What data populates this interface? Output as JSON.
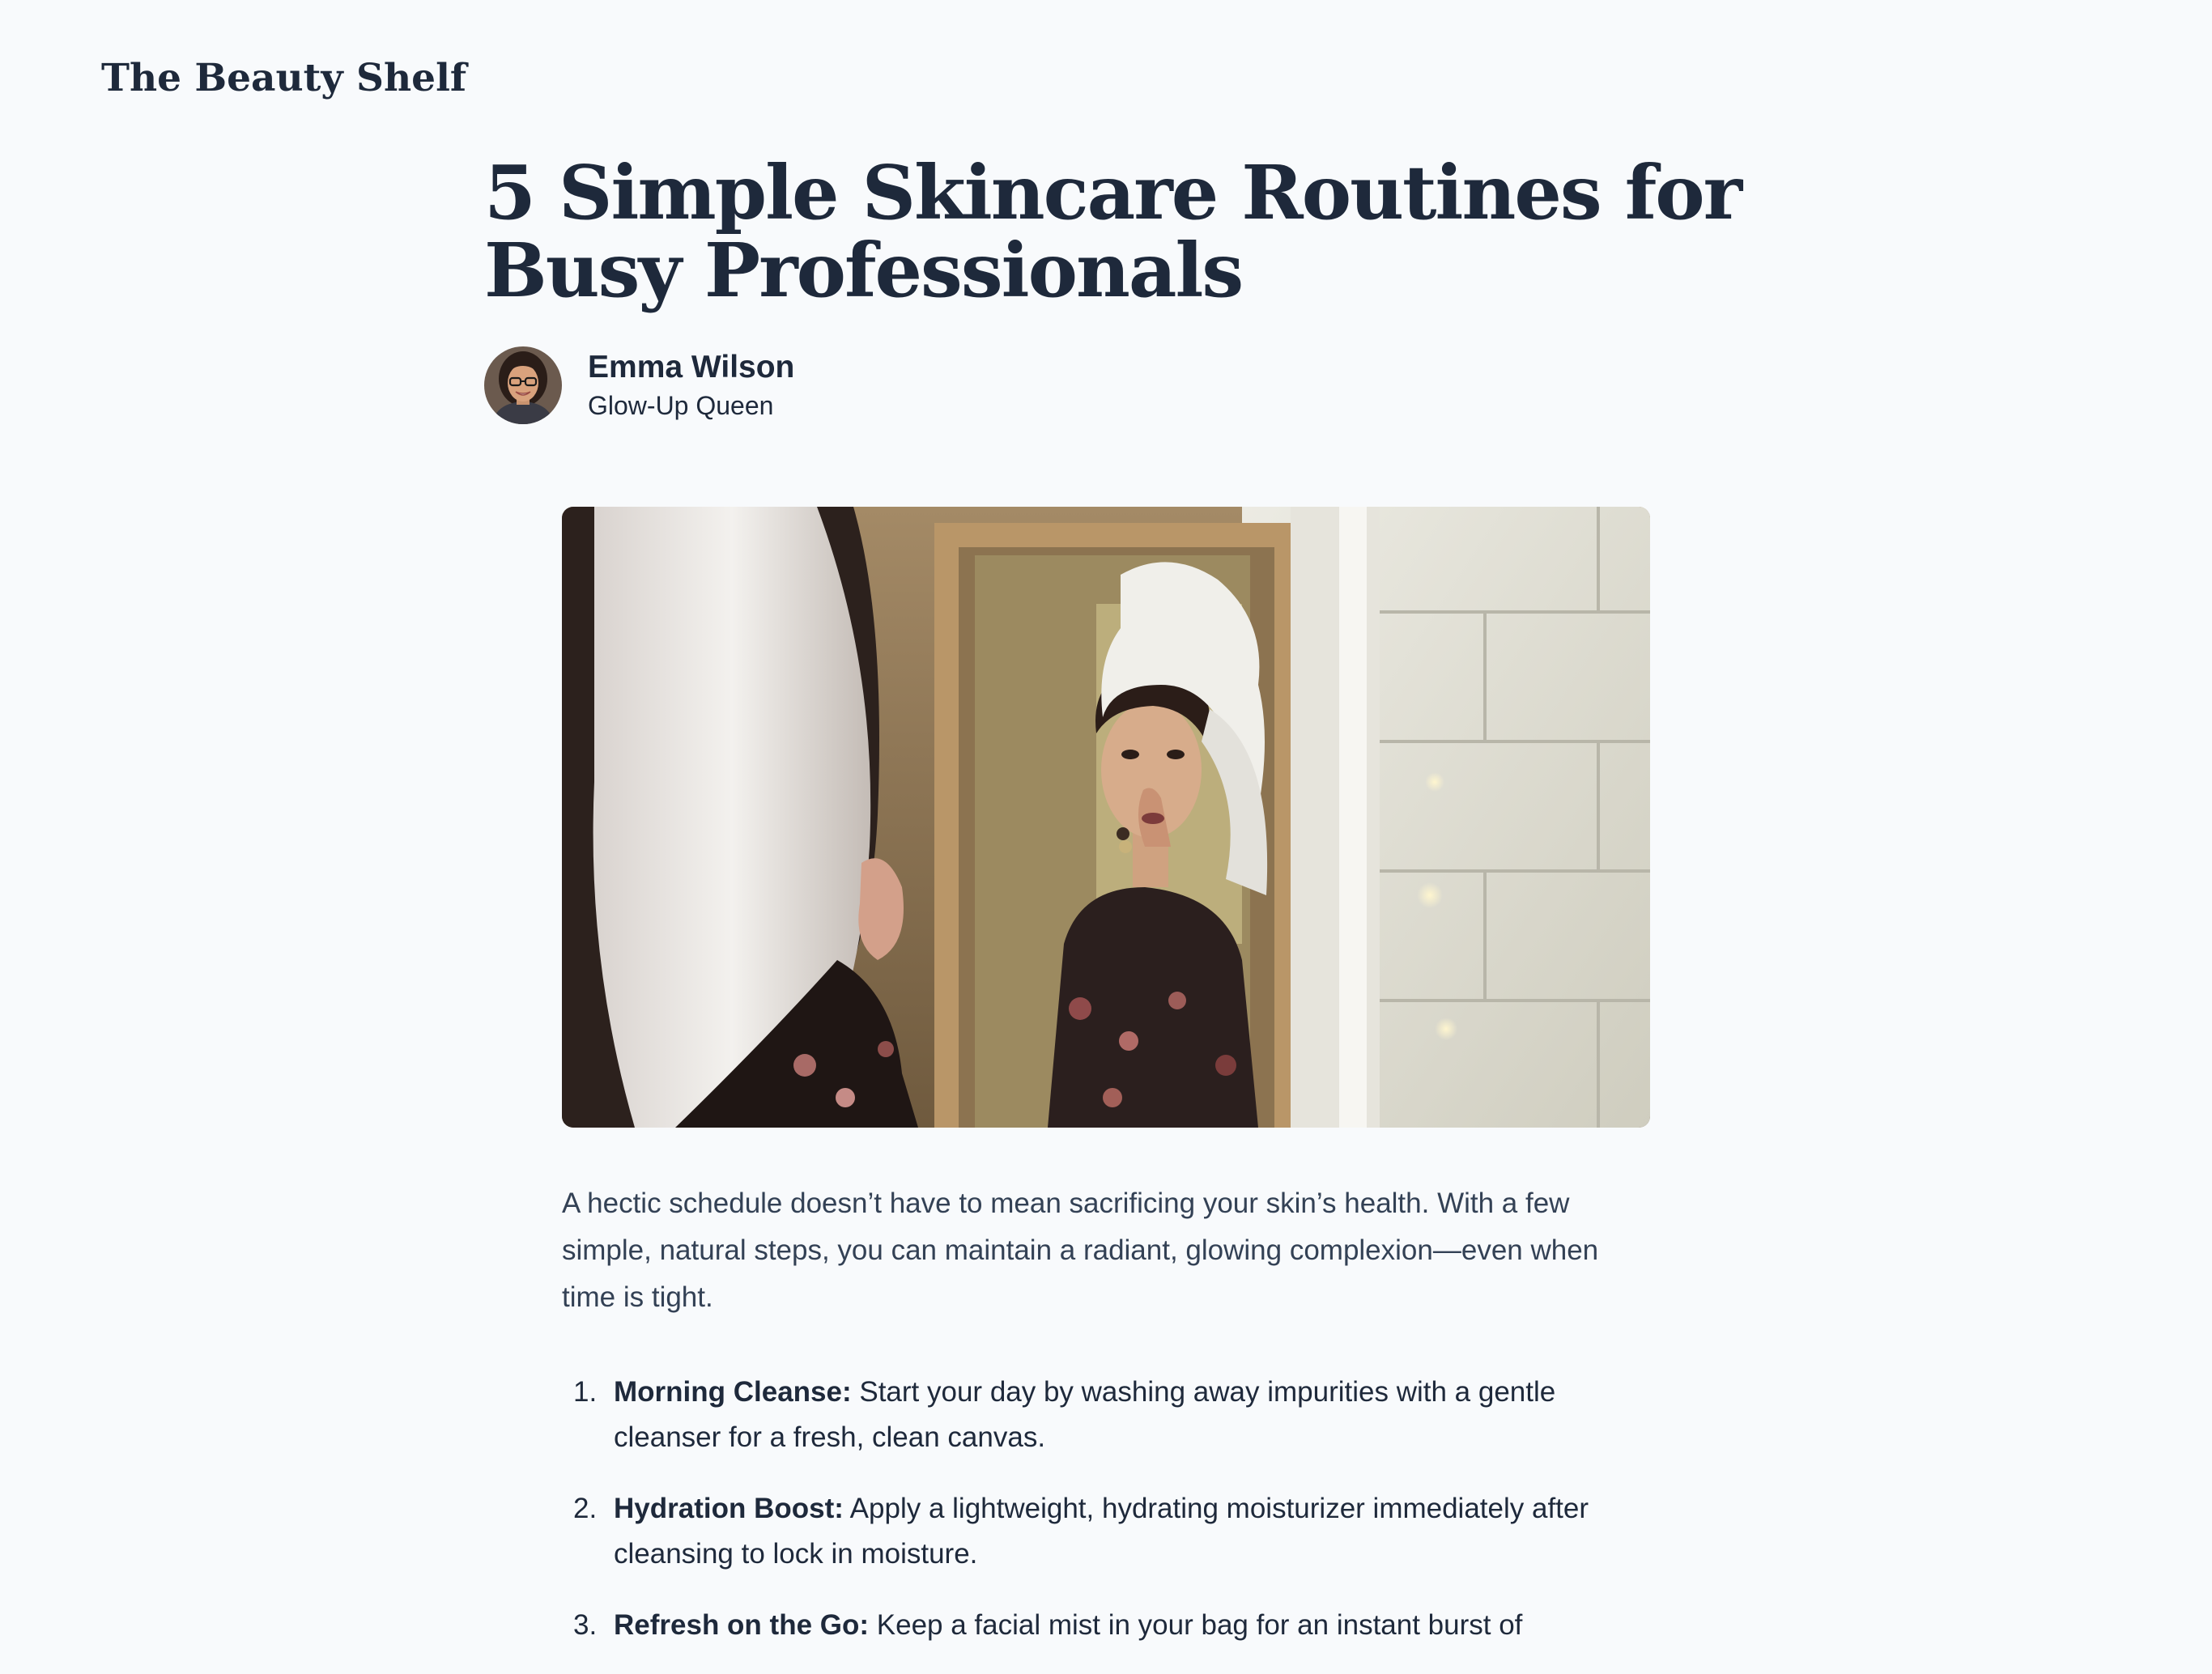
{
  "site": {
    "name": "The Beauty Shelf"
  },
  "article": {
    "title": "5 Simple Skincare Routines for Busy Professionals",
    "author": {
      "name": "Emma Wilson",
      "tagline": "Glow-Up Queen"
    },
    "intro": "A hectic schedule doesn’t have to mean sacrificing your skin’s health. With a few simple, natural steps, you can maintain a radiant, glowing complexion—even when time is tight.",
    "tips": [
      {
        "number": "1.",
        "label": "Morning Cleanse:",
        "text": " Start your day by washing away impurities with a gentle cleanser for a fresh, clean canvas."
      },
      {
        "number": "2.",
        "label": "Hydration Boost:",
        "text": " Apply a lightweight, hydrating moisturizer immediately after cleansing to lock in moisture."
      },
      {
        "number": "3.",
        "label": "Refresh on the Go:",
        "text": " Keep a facial mist in your bag for an instant burst of"
      }
    ]
  },
  "theme": {
    "background": "#f8fafc",
    "text": "#1e293b",
    "body_text": "#334155"
  }
}
